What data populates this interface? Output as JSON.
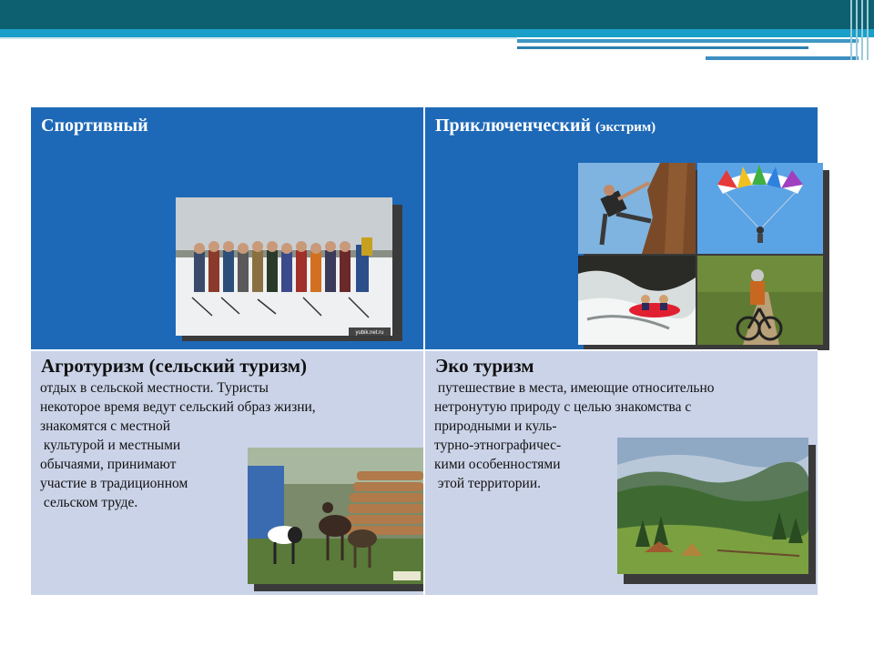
{
  "cells": {
    "sport": {
      "title": "Спортивный"
    },
    "adventure": {
      "title": "Приключенческий",
      "title_note": "(экстрим)"
    },
    "agro": {
      "title": "Агротуризм  (сельский туризм)",
      "lines": [
        "отдых в сельской местности. Туристы",
        "некоторое время ведут сельский образ жизни,",
        "знакомятся с местной",
        " культурой и местными",
        "обычаями, принимают",
        "участие в традиционном",
        " сельском труде."
      ]
    },
    "eco": {
      "title": "Эко туризм",
      "lines": [
        " путешествие в места, имеющие относительно",
        "нетронутую природу с целью знакомства с",
        "природными и куль-",
        "турно-этнографичес-",
        "кими особенностями",
        " этой территории."
      ]
    }
  },
  "watermark": "yubik.net.ru",
  "colors": {
    "header_blue": "#1e69b7",
    "body_lavender": "#cbd3e8",
    "header_dark": "#0d6070",
    "header_cyan": "#1aa0c8"
  },
  "icons": [
    "ski-group-photo",
    "climber-photo",
    "parachute-photo",
    "rafting-photo",
    "cyclist-photo",
    "goats-photo",
    "mountain-valley-photo"
  ]
}
